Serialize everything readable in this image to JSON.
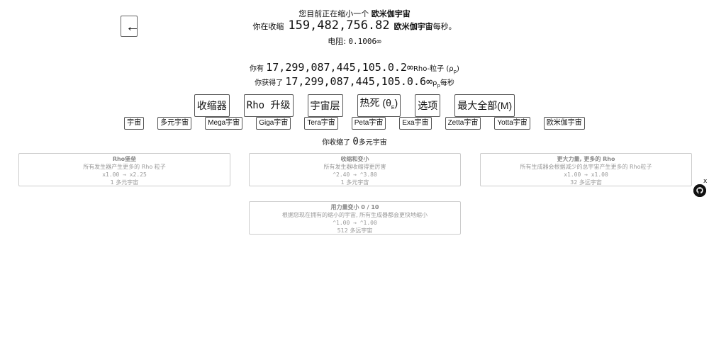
{
  "header": {
    "back_label": "←",
    "shrink_prefix": "您目前正在缩小一个",
    "shrink_target": "欧米伽宇宙",
    "rate_prefix": "你在收缩",
    "rate_value": "159,482,756.82",
    "rate_unit": "欧米伽宇宙",
    "rate_suffix": "每秒。",
    "resistance_label": "电阻:",
    "resistance_value": "0.1006∞"
  },
  "rho": {
    "have_prefix": "你有",
    "have_value": "17,299,087,445,105.0.2∞",
    "have_unit": "Rho-粒子 (ρ",
    "have_sub": "p",
    "have_close": ")",
    "gain_prefix": "你获得了",
    "gain_value": "17,299,087,445,105.0.6∞",
    "gain_unit": "ρ",
    "gain_sub": "p",
    "gain_suffix": "每秒"
  },
  "tabs": [
    {
      "label": "收缩器"
    },
    {
      "label": "Rho 升级"
    },
    {
      "label": "宇宙层"
    },
    {
      "label": "热死 (θ"
    },
    {
      "label": "选项"
    },
    {
      "label": "最大全部(M)"
    }
  ],
  "heat_death_sub": "E",
  "heat_death_close": ")",
  "subtabs": [
    {
      "label": "宇宙"
    },
    {
      "label": "多元宇宙"
    },
    {
      "label": "Mega宇宙"
    },
    {
      "label": "Giga宇宙"
    },
    {
      "label": "Tera宇宙"
    },
    {
      "label": "Peta宇宙"
    },
    {
      "label": "Exa宇宙"
    },
    {
      "label": "Zetta宇宙"
    },
    {
      "label": "Yotta宇宙"
    },
    {
      "label": "欧米伽宇宙"
    }
  ],
  "shrunk": {
    "prefix": "你收缩了",
    "value": "0",
    "unit": "多元宇宙"
  },
  "upgrades": [
    {
      "title": "Rho堡垒",
      "desc": "所有发生器产生更多的 Rho 粒子",
      "effect": "x1.00 → x2.25",
      "cost": "1 多元宇宙"
    },
    {
      "title": "收缩和变小",
      "desc": "所有发生器收缩得更厉害",
      "effect": "^2.40 → ^3.80",
      "cost": "1 多元宇宙"
    },
    {
      "title": "更大力量, 更多的 Rho",
      "desc": "所有生成器会根据减少的总宇宙产生更多的 Rho粒子",
      "effect": "x1.00 → x1.00",
      "cost": "32 多远宇宙"
    },
    {
      "title": "用力量变小 0 / 10",
      "desc": "根据您现在拥有的缩小的宇宙, 所有生成器都会更快地缩小",
      "effect": "^1.00 → ^1.00",
      "cost": "512 多远宇宙"
    }
  ],
  "side_close": "x"
}
